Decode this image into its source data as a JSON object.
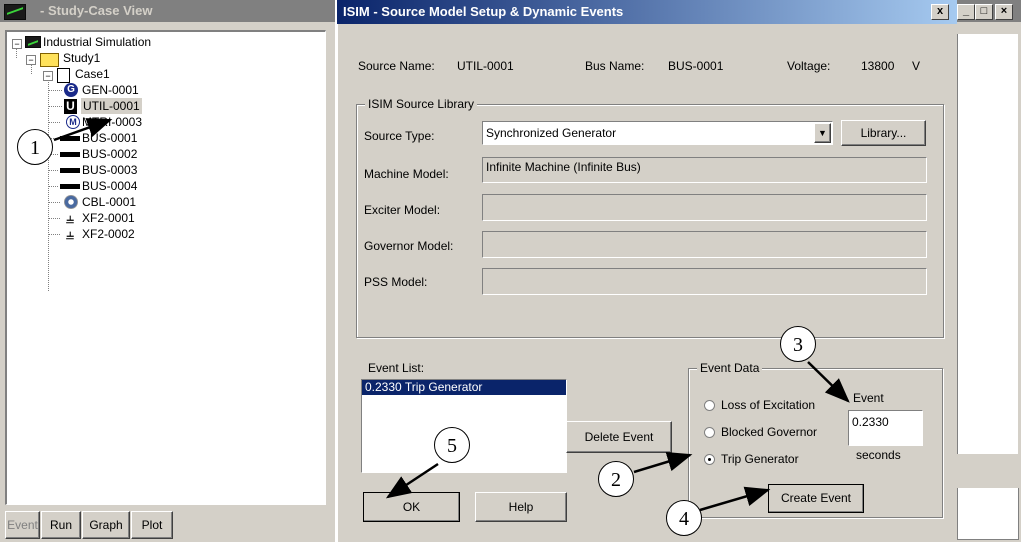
{
  "tree_window": {
    "title": "- Study-Case View",
    "root_label": "Industrial Simulation",
    "study_label": "Study1",
    "case_label": "Case1",
    "items": [
      {
        "label": "GEN-0001",
        "icon": "generator-icon"
      },
      {
        "label": "UTIL-0001",
        "icon": "utility-icon",
        "selected": true
      },
      {
        "label": "MTRI-0003",
        "icon": "motor-icon"
      },
      {
        "label": "BUS-0001",
        "icon": "bus-icon"
      },
      {
        "label": "BUS-0002",
        "icon": "bus-icon"
      },
      {
        "label": "BUS-0003",
        "icon": "bus-icon"
      },
      {
        "label": "BUS-0004",
        "icon": "bus-icon"
      },
      {
        "label": "CBL-0001",
        "icon": "cable-icon"
      },
      {
        "label": "XF2-0001",
        "icon": "transformer-icon"
      },
      {
        "label": "XF2-0002",
        "icon": "transformer-icon"
      }
    ],
    "buttons": {
      "event": "Event",
      "run": "Run",
      "graph": "Graph",
      "plot": "Plot"
    }
  },
  "dialog": {
    "title": "ISIM - Source Model Setup & Dynamic Events",
    "close": "x",
    "source_name_label": "Source Name:",
    "source_name_value": "UTIL-0001",
    "bus_name_label": "Bus Name:",
    "bus_name_value": "BUS-0001",
    "voltage_label": "Voltage:",
    "voltage_value": "13800",
    "voltage_unit": "V",
    "library_group": "ISIM Source Library",
    "source_type_label": "Source Type:",
    "source_type_value": "Synchronized Generator",
    "library_button": "Library...",
    "machine_model_label": "Machine Model:",
    "machine_model_value": "Infinite Machine (Infinite Bus)",
    "exciter_model_label": "Exciter Model:",
    "governor_model_label": "Governor Model:",
    "pss_model_label": "PSS Model:",
    "event_list_label": "Event List:",
    "event_list_items": [
      "0.2330 Trip Generator"
    ],
    "delete_event_button": "Delete Event",
    "event_data_group": "Event Data",
    "radio_loss_excitation": "Loss of Excitation",
    "radio_blocked_governor": "Blocked Governor",
    "radio_trip_generator": "Trip Generator",
    "event_time_label": "Event",
    "event_time_value": "0.2330",
    "seconds_label": "seconds",
    "create_event_button": "Create Event",
    "ok_button": "OK",
    "help_button": "Help"
  },
  "callouts": [
    "1",
    "2",
    "3",
    "4",
    "5"
  ]
}
